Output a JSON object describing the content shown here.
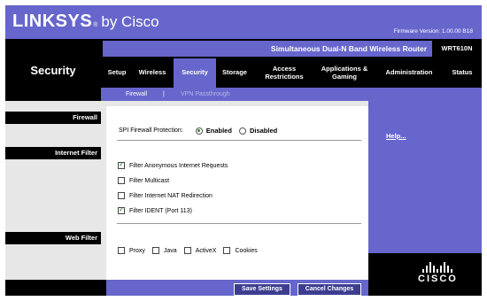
{
  "header": {
    "brand": "LINKSYS",
    "by": "by Cisco",
    "firmware": "Firmware Version: 1.00.00 B18",
    "router_name": "Simultaneous Dual-N Band Wireless Router",
    "model": "WRT610N"
  },
  "page_title": "Security",
  "tabs": [
    {
      "label": "Setup"
    },
    {
      "label": "Wireless"
    },
    {
      "label": "Security"
    },
    {
      "label": "Storage"
    },
    {
      "label": "Access Restrictions"
    },
    {
      "label": "Applications & Gaming"
    },
    {
      "label": "Administration"
    },
    {
      "label": "Status"
    }
  ],
  "subtabs": {
    "firewall": "Firewall",
    "separator": "|",
    "vpn": "VPN Passthrough"
  },
  "sections": {
    "firewall": "Firewall",
    "internet_filter": "Internet Filter",
    "web_filter": "Web Filter"
  },
  "spi": {
    "label": "SPI Firewall Protection:",
    "enabled": "Enabled",
    "disabled": "Disabled",
    "selected": "Enabled"
  },
  "internet_filter": [
    {
      "label": "Filter Anonymous Internet Requests",
      "checked": true
    },
    {
      "label": "Filter Multicast",
      "checked": false
    },
    {
      "label": "Filter Internet NAT Redirection",
      "checked": false
    },
    {
      "label": "Filter IDENT (Port 113)",
      "checked": true
    }
  ],
  "web_filter": [
    {
      "label": "Proxy",
      "checked": false
    },
    {
      "label": "Java",
      "checked": false
    },
    {
      "label": "ActiveX",
      "checked": false
    },
    {
      "label": "Cookies",
      "checked": false
    }
  ],
  "help": "Help...",
  "buttons": {
    "save": "Save Settings",
    "cancel": "Cancel Changes"
  },
  "footer_logo": "CISCO",
  "colors": {
    "accent": "#6666cc",
    "black": "#000000",
    "panel_gray": "#e7e7e7",
    "subtab_active": "#ffffff",
    "subtab_inactive": "#b8b8e8"
  }
}
